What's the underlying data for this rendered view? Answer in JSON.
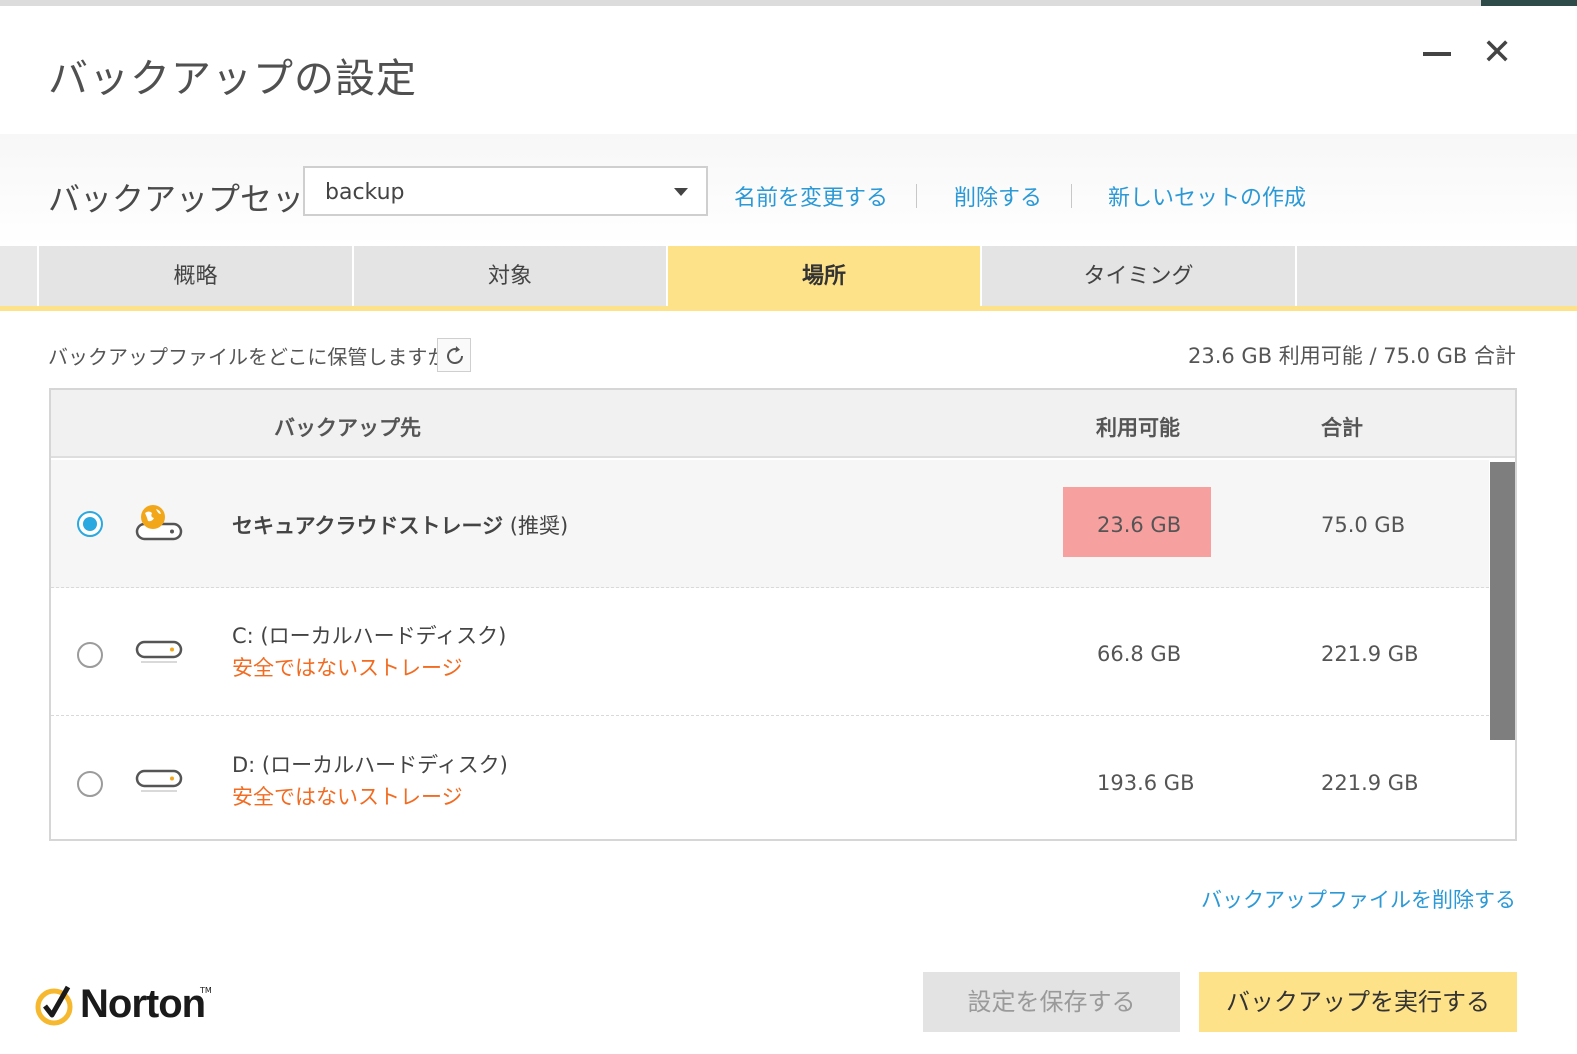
{
  "window": {
    "title": "バックアップの設定",
    "minimize_icon": "minimize-icon",
    "close_glyph": "✕"
  },
  "backup_set": {
    "label": "バックアップセット",
    "selected": "backup",
    "links": {
      "rename": "名前を変更する",
      "delete": "削除する",
      "new_set": "新しいセットの作成"
    }
  },
  "tabs": [
    {
      "label": "概略",
      "active": false
    },
    {
      "label": "対象",
      "active": false
    },
    {
      "label": "場所",
      "active": true
    },
    {
      "label": "タイミング",
      "active": false
    }
  ],
  "location": {
    "question": "バックアップファイルをどこに保管しますか?",
    "capacity_summary": "23.6 GB 利用可能 / 75.0 GB 合計",
    "columns": {
      "destination": "バックアップ先",
      "available": "利用可能",
      "total": "合計"
    },
    "rows": [
      {
        "name": "セキュアクラウドストレージ",
        "suffix": " (推奨)",
        "warning": "",
        "available": "23.6 GB",
        "total": "75.0 GB",
        "selected": true,
        "icon": "cloud-storage-icon"
      },
      {
        "name": "C:  (ローカルハードディスク)",
        "warning": "安全ではないストレージ",
        "available": "66.8 GB",
        "total": "221.9 GB",
        "selected": false,
        "icon": "hard-drive-icon"
      },
      {
        "name": "D:  (ローカルハードディスク)",
        "warning": "安全ではないストレージ",
        "available": "193.6 GB",
        "total": "221.9 GB",
        "selected": false,
        "icon": "hard-drive-icon"
      }
    ],
    "delete_files_link": "バックアップファイルを削除する"
  },
  "footer": {
    "brand": "Norton",
    "brand_tm": "TM",
    "save_button": "設定を保存する",
    "run_button": "バックアップを実行する"
  },
  "colors": {
    "accent_yellow": "#fde28a",
    "link_blue": "#2b99d6",
    "warning_orange": "#f26b21",
    "highlight_red": "#f7a0a0",
    "radio_blue": "#2aa8e0"
  }
}
